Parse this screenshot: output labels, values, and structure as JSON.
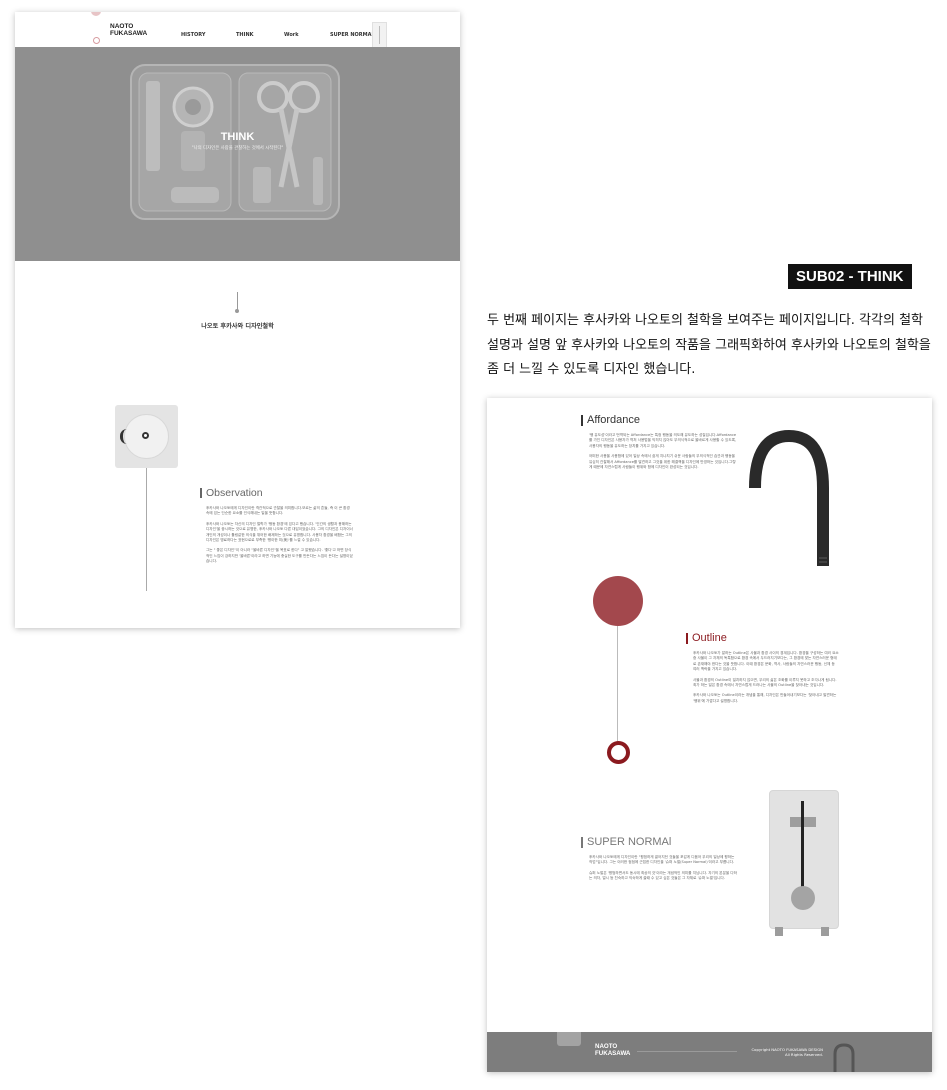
{
  "left_page": {
    "logo": {
      "line1": "NAOTO",
      "line2": "FUKASAWA"
    },
    "nav": [
      "HISTORY",
      "THINK",
      "Work",
      "SUPER NORMAL"
    ],
    "hero": {
      "title": "THINK",
      "subtitle": "\"나의 디자인은 사람을 관찰하는 것에서 시작된다\""
    },
    "intro_heading": "나오토 후카사와 디자인철학",
    "observation": {
      "title": "Observation",
      "paragraphs": [
        "후카사와 나오토에게 디자인이란 객관적으로 관찰을 의미합니다.모르는 삶의 흔들, 즉 이 큰 환경 속에 있는 단순한 요소를 인식해내는 일을 뜻합니다.",
        "후카사와 나오토는 자신의 디자인 철학가 '행동 환경'에 있다고 했습니다. '인간의 생활과 용해하는 디자인'을 중시하는 것으로 유명한, 후카사와 나오토 다른 대답이었습니다. 그의 디자인은 디자이너 개인의 개성이나 톨링같한 의식을 뛰어한 배제하는 것으로 유명합니다. 사용자 환경을 배합는 그의 디자인은 명료하다는 표현으로로 부족한 '평이한 미(美)'를 느낄 수 있습니다.",
        "그는 \" 좋은 디자인\"이 아니라 \"올바른 디자인\"을 목표로 한다\" 고 말했습니다. '좋다'고 하면 장식적인 느낌이 강하지만 '올바른'이라고 하면 기능에 충실한 도구를 만든다는 느낌이 든다는 설명이었습니다."
      ]
    }
  },
  "annotation": {
    "tag": "SUB02 - THINK",
    "description": "두 번째 페이지는 후사카와 나오토의 철학을 보여주는 페이지입니다. 각각의 철학 설명과 설명 앞 후사카와 나오토의 작품을 그래픽화하여  후사카와 나오토의 철학을 좀 더 느낄 수 있도록 디자인 했습니다."
  },
  "right_page": {
    "affordance": {
      "title": "Affordance",
      "paragraphs": [
        "'행 유도성'이라고 번역되는 Affordance는 특정 행동을 의도해 유도하는 성질입니다.Affordance를 가진 디자인은 사용자가 역처 사용법을 익히지 않아도 무의식적으로 올바르게 사용할 수 있도록, 사용자의 행동을 유도하는 장치를 가지고 있습니다.",
        "어떠한 사용을 사용함에 있어 일상 속에서 쉽게 지나치기 쉬운 사람들의 무의식적인 습관과 행동을 유심히 관찰해서 Affordance를 발견하고 그것을 위한 해결책을 디자인에 반영하는 것입니다.그렇게 때문에 자연스럽게 사람들이 행위와 함께 디자인이 완성되는 것입니다."
      ]
    },
    "outline": {
      "title": "Outline",
      "paragraphs": [
        "후카사와 나오토가 말하는 Outline은 사물과 환경 사이의 경계입니다. 환경을 구성하는 여러 요소 중 사물이 그 자체의 독특함으로 환경 속에서 두드러지기보다는, 그 환경에 맞는 자연스러운 형태로 존재해야 한다는 것을 뜻합니다. 이때 환경은 문화, 역사, 사람들의 자연스러운 행동, 신체 등 여러 맥락을 가지고 있습니다.",
        "사물과 환경의 Outline이 일치하지 않으면, 우리의 삶은 조화를 이루지 못하고 조각나게 됩니다. 최가 하는 일은 환경 속에서 자연스럽게 드러나는 사물의 Outline을 찾아내는 것입니다.",
        "후카사와 나오토는 Outline이라는 개념을 통해, 디자인은 만들어내기보다는 '찾아내고 발견하는 '행위'에 가깝다고 설명합니다."
      ]
    },
    "super_normal": {
      "title": "SUPER NORMAl",
      "paragraphs": [
        "후카사와 나오토에게 디자인이란 \"평범하게 끌어지던 것들을 포갑게 디움어 우리의 일상에 평하는 작업\"입니다. 그는 이러한 점점에 근접한 디자인을 '슈퍼 노멀(Super Normal)'이라고 부릅니다.",
        "슈퍼 노멀은 '평범하면서도 동시에 최상의 것'이라는 개념적인 의미를 지닙니다. 자기의 본분을 다하는 의자, 얼시 등 친숙하고 익숙하게 쓸때 수 있고 싶은 것들은 그 자체로 '슈퍼 노멀'입니다."
      ]
    },
    "footer": {
      "logo_line1": "NAOTO",
      "logo_line2": "FUKASAWA",
      "copyright1": "Copyright NAOTO FUKASAWA DESIGN",
      "copyright2": "All Rights Reserved."
    }
  },
  "colors": {
    "accent_red": "#a3484d",
    "dark_red": "#8b1a1f",
    "hero_gray": "#8f8f8f",
    "footer_gray": "#7d7d7d",
    "tag_bg": "#111111"
  }
}
